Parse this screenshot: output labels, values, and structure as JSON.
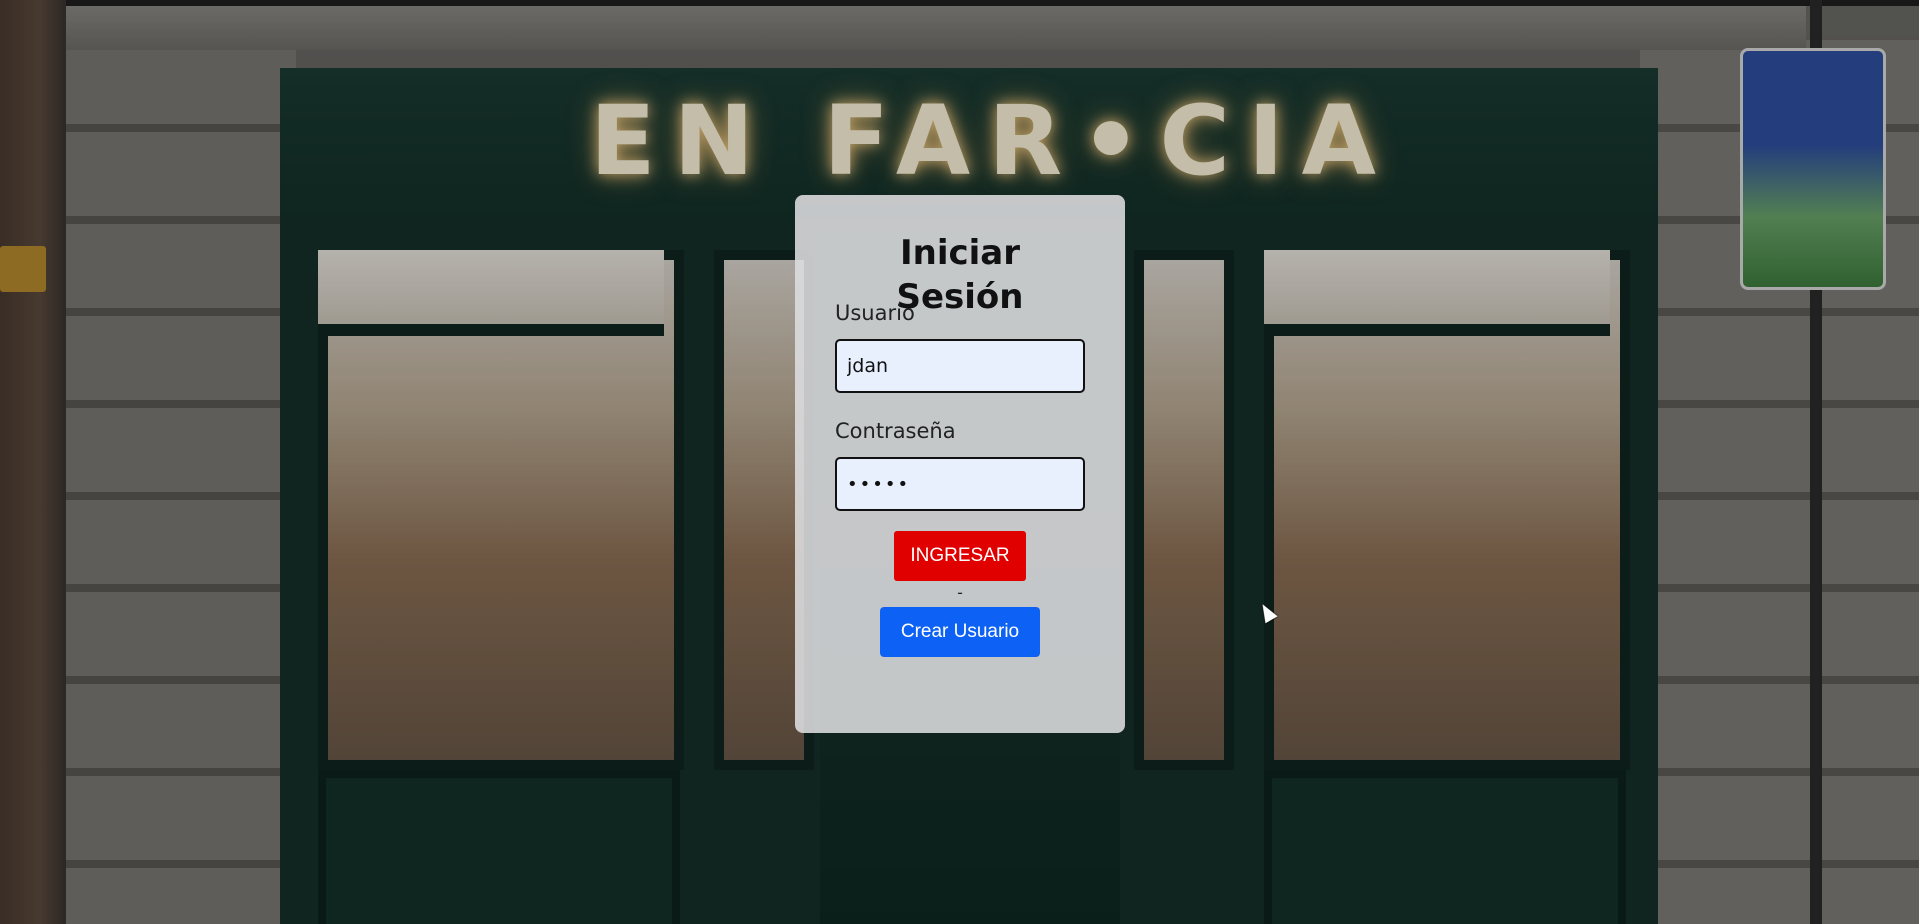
{
  "background": {
    "sign_text": "EN FAR•CIA"
  },
  "login": {
    "title": "Iniciar Sesión",
    "username_label": "Usuario",
    "username_value": "jdan",
    "password_label": "Contraseña",
    "password_value": "•••••",
    "submit_label": "INGRESAR",
    "separator": "-",
    "create_label": "Crear Usuario"
  },
  "colors": {
    "submit_button": "#e00000",
    "create_button": "#0d62f5",
    "input_background": "#e8f0fe"
  },
  "icons": {
    "cursor": "mouse-pointer-icon"
  }
}
